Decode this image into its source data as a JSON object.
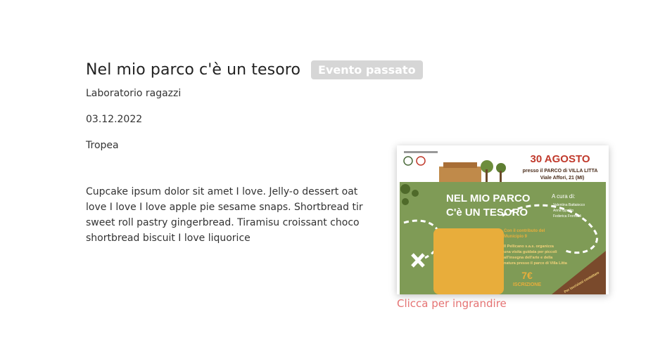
{
  "event": {
    "title": "Nel mio parco c'è un tesoro",
    "status_badge": "Evento passato",
    "category": "Laboratorio ragazzi",
    "date": "03.12.2022",
    "location": "Tropea",
    "description_lines": [
      "Cupcake ipsum dolor sit amet I love. Jelly-o dessert oat",
      "love I love I love apple pie sesame snaps. Shortbread tir",
      "sweet roll pastry gingerbread. Tiramisu croissant choco",
      "shortbread biscuit I love liquorice"
    ]
  },
  "poster": {
    "date_line": "30 AGOSTO",
    "venue_line": "presso il PARCO di VILLA LITTA",
    "address_line": "Viale Affori, 21 (MI)",
    "title_line1": "NEL MIO PARCO",
    "title_line2": "C'è UN TESORO",
    "curated_by": "A cura di:",
    "curators": [
      "Valentina Battaiocco",
      "Anna Ippolito",
      "Federica Frombali"
    ],
    "contrib_line1": "Con il contributo del",
    "contrib_line2": "Municipio 9",
    "organizer_line1": "Il Pellicano s.a.s. organizza",
    "organizer_line2": "una visita guidata per piccoli",
    "organizer_line3": "all'insegna dell'arte e della",
    "organizer_line4": "natura presso il parco di Villa Litta",
    "price": "7€",
    "price_label": "ISCRIZIONE",
    "info_line": "Per iscrizioni contattare",
    "colors": {
      "grass": "#7f9b56",
      "path": "#ffffff",
      "orange": "#e8ad3b",
      "brown": "#7a4a2c",
      "red": "#c0392b"
    }
  },
  "enlarge_link": "Clicca per ingrandire"
}
